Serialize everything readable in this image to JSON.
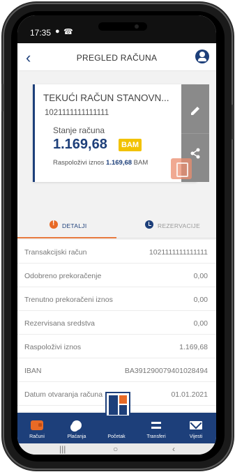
{
  "status_bar": {
    "time": "17:35"
  },
  "header": {
    "title": "PREGLED RAČUNA"
  },
  "account_card": {
    "name": "TEKUĆI RAČUN STANOVN...",
    "number": "1021111111111111",
    "balance_label": "Stanje računa",
    "balance_value": "1.169,68",
    "currency": "BAM",
    "available_label": "Raspoloživi iznos",
    "available_value": "1.169,68",
    "available_currency": "BAM"
  },
  "tabs": [
    {
      "label": "DETALJI",
      "active": true
    },
    {
      "label": "REZERVACIJE",
      "active": false
    }
  ],
  "details": [
    {
      "label": "Transakcijski račun",
      "value": "1021111111111111"
    },
    {
      "label": "Odobreno prekoračenje",
      "value": "0,00"
    },
    {
      "label": "Trenutno prekoračeni iznos",
      "value": "0,00"
    },
    {
      "label": "Rezervisana sredstva",
      "value": "0,00"
    },
    {
      "label": "Raspoloživi iznos",
      "value": "1.169,68"
    },
    {
      "label": "IBAN",
      "value": "BA391290079401028494"
    },
    {
      "label": "Datum otvaranja računa",
      "value": "01.01.2021"
    }
  ],
  "bottom_nav": [
    {
      "label": "Računi",
      "icon": "wallet-icon"
    },
    {
      "label": "Plaćanja",
      "icon": "coins-icon"
    },
    {
      "label": "Početak",
      "icon": "home-tile-icon"
    },
    {
      "label": "Transferi",
      "icon": "transfer-icon"
    },
    {
      "label": "Vijesti",
      "icon": "mail-icon"
    }
  ],
  "colors": {
    "brand_blue": "#1d3f7a",
    "accent_orange": "#e86a26",
    "currency_badge": "#f2c200",
    "action_gray": "#8a8a8a"
  }
}
